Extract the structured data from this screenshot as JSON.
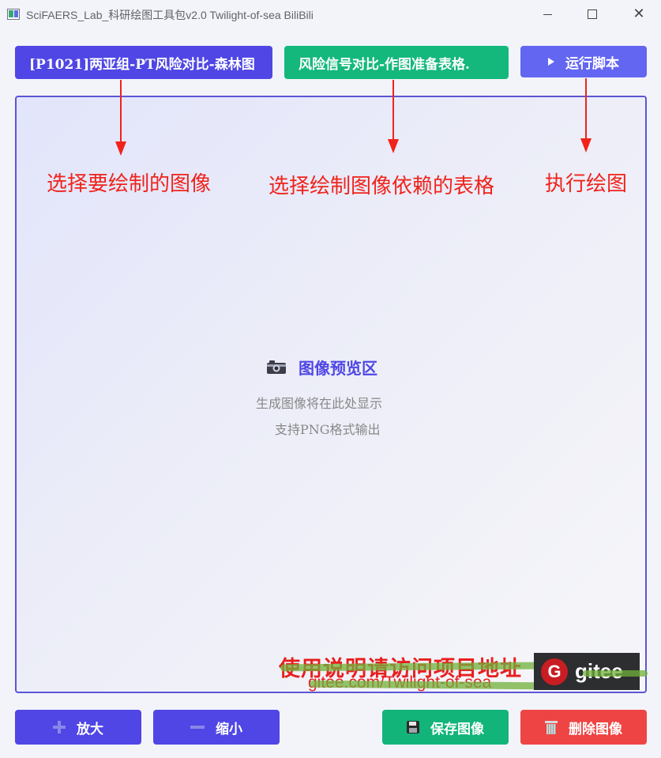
{
  "window": {
    "title": "SciFAERS_Lab_科研绘图工具包v2.0 Twilight-of-sea BiliBili",
    "minimize_label": "—",
    "maximize_label": "☐",
    "close_label": "✕"
  },
  "toolbar": {
    "image_select_label": "[P1021]两亚组-PT风险对比-森林图",
    "table_select_label": "风险信号对比-作图准备表格.",
    "run_label": "运行脚本"
  },
  "annotations": {
    "select_image": "选择要绘制的图像",
    "select_table": "选择绘制图像依赖的表格",
    "run_plot": "执行绘图",
    "arrow_color": "#f0231c"
  },
  "preview": {
    "title": "图像预览区",
    "line1": "生成图像将在此处显示",
    "line2": "支持PNG格式输出",
    "icon": "camera-icon"
  },
  "promo": {
    "usage_text": "使用说明请访问项目地址",
    "url": "gitee.com/Twilight-of-sea",
    "badge_letter": "G",
    "badge_word": "gitee"
  },
  "bottom": {
    "zoom_in_label": "放大",
    "zoom_out_label": "缩小",
    "save_label": "保存图像",
    "delete_label": "删除图像"
  },
  "colors": {
    "primary": "#4f46e5",
    "success": "#14b87c",
    "run": "#6366f1",
    "danger": "#ef4444",
    "annotation_red": "#f0231c"
  }
}
